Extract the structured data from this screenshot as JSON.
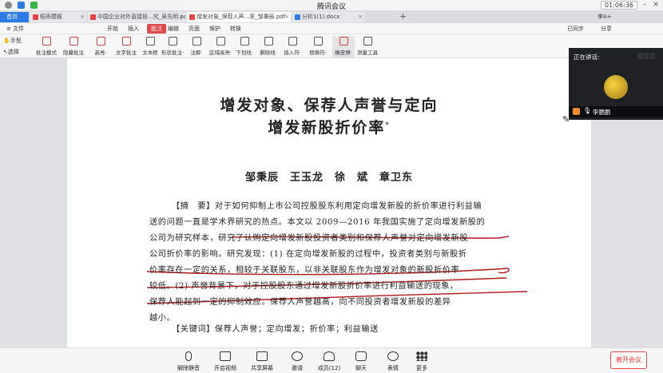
{
  "app": {
    "title": "腾讯会议",
    "timer": "01:06:36"
  },
  "tabs": [
    {
      "label": "首页",
      "color": "#2d7be5",
      "active": true
    },
    {
      "label": "稻壳模板",
      "color": "#e94444"
    },
    {
      "label": "中国企业对外直接投...究_吴先明.pdf",
      "color": "#e94444"
    },
    {
      "label": "增发对象_保荐人声...率_邹秉辰.pdf",
      "color": "#e94444",
      "active": true
    },
    {
      "label": "分析1(1).docx",
      "color": "#2d7be5"
    }
  ],
  "tab_extra": {
    "plus": "+",
    "user": "李A+"
  },
  "menus": [
    "≡ 文件",
    "开始",
    "插入",
    "批注",
    "编辑",
    "页面",
    "保护",
    "转换"
  ],
  "menu_active": "批注",
  "menu_right": {
    "sync": "已同步",
    "share": "分享"
  },
  "tools": [
    {
      "label": "批注模式",
      "color": "#d04040"
    },
    {
      "label": "隐藏批注",
      "color": "#d04040"
    },
    {
      "label": "高亮·",
      "color": "#d04040"
    },
    {
      "label": "文字批注",
      "color": "#d04040"
    },
    {
      "label": "文本框",
      "color": "#555555"
    },
    {
      "label": "形状批注·",
      "color": "#555555"
    },
    {
      "label": "注解·",
      "color": "#555555"
    },
    {
      "label": "区域高亮·",
      "color": "#555555"
    },
    {
      "label": "下划线·",
      "color": "#555555"
    },
    {
      "label": "删除线·",
      "color": "#555555"
    },
    {
      "label": "插入符·",
      "color": "#555555"
    },
    {
      "label": "替换符·",
      "color": "#555555"
    },
    {
      "label": "橡皮擦·",
      "color": "#d04040"
    },
    {
      "label": "测量工具",
      "color": "#555555"
    }
  ],
  "side_tools": {
    "hand": "手型",
    "select": "选择"
  },
  "speaker": {
    "header": "正在讲话:",
    "name": "李鹏鹏"
  },
  "doc": {
    "title1": "增发对象、保荐人声誉与定向",
    "title2": "增发新股折价率",
    "title2_mark": "*",
    "authors": "邹秉辰　王玉龙　徐　斌　章卫东",
    "abstract_lines": [
      "【摘　要】对于如何抑制上市公司控股股东利用定向增发新股的折价率进行利益输",
      "送的问题一直是学术界研究的热点。本文以 2009—2016 年我国实施了定向增发新股的",
      "公司为研究样本，研究了认购定向增发新股投资者类别和保荐人声誉对定向增发新股",
      "公司折价率的影响。研究发现：(1) 在定向增发新股的过程中，投资者类别与新股折",
      "价率存在一定的关系，相较于关联股东，以非关联股东作为增发对象的新股折价率",
      "较低。(2) 声誉背景下，对于控股股东通过增发新股折价率进行利益输送的现象，",
      "保荐人能起到一定的抑制效应。保荐人声誉越高，向不同投资者增发新股的差异",
      "越小。"
    ],
    "keywords": "【关键词】保荐人声誉；定向增发；折价率；利益输送"
  },
  "bottom": [
    {
      "label": "解除静音",
      "icon": "mic-muted-icon"
    },
    {
      "label": "开启视频",
      "icon": "camera-off-icon"
    },
    {
      "label": "共享屏幕",
      "icon": "screen-share-icon"
    },
    {
      "label": "邀请",
      "icon": "invite-icon"
    },
    {
      "label": "成员(12)",
      "icon": "members-icon"
    },
    {
      "label": "聊天",
      "icon": "chat-icon"
    },
    {
      "label": "表情",
      "icon": "emoji-icon"
    },
    {
      "label": "更多",
      "icon": "more-icon"
    }
  ],
  "leave": "离开会议",
  "colors": {
    "accent": "#e14a4a",
    "annotation": "#b01818",
    "speaker_bg": "#1f2125"
  }
}
